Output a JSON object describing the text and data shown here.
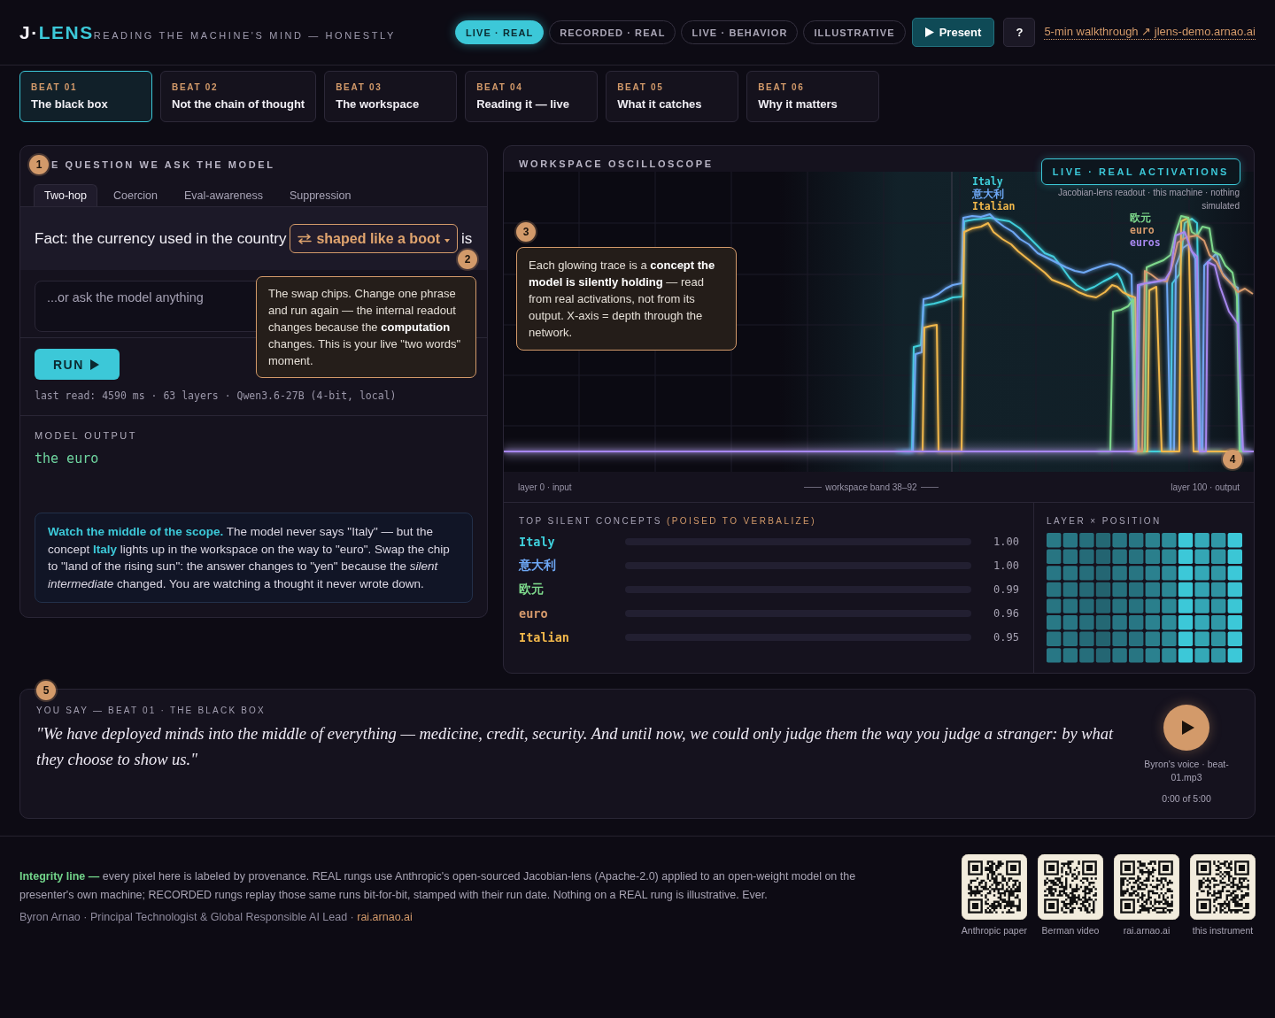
{
  "header": {
    "logo": {
      "mark": "J·",
      "accent": "LENS"
    },
    "tagline": "READING THE MACHINE'S MIND — HONESTLY",
    "modes": [
      {
        "label": "LIVE · REAL",
        "selected": true
      },
      {
        "label": "RECORDED · REAL",
        "selected": false
      },
      {
        "label": "LIVE · BEHAVIOR",
        "selected": false
      },
      {
        "label": "ILLUSTRATIVE",
        "selected": false
      }
    ],
    "present_button": {
      "label": "Present"
    },
    "help_button": {
      "label": "?"
    },
    "walkthrough_link": {
      "label": "5-min walkthrough ↗ jlens-demo.arnao.ai"
    }
  },
  "beats": [
    {
      "number": "BEAT 01",
      "title": "The black box",
      "selected": true
    },
    {
      "number": "BEAT 02",
      "title": "Not the chain of thought",
      "selected": false
    },
    {
      "number": "BEAT 03",
      "title": "The workspace",
      "selected": false
    },
    {
      "number": "BEAT 04",
      "title": "Reading it — live",
      "selected": false
    },
    {
      "number": "BEAT 05",
      "title": "What it catches",
      "selected": false
    },
    {
      "number": "BEAT 06",
      "title": "Why it matters",
      "selected": false
    }
  ],
  "question_panel": {
    "badge": "1",
    "title": "E QUESTION WE ASK THE MODEL",
    "tabs": [
      {
        "label": "Two-hop",
        "selected": true
      },
      {
        "label": "Coercion",
        "selected": false
      },
      {
        "label": "Eval-awareness",
        "selected": false
      },
      {
        "label": "Suppression",
        "selected": false
      }
    ],
    "prompt": {
      "before": "Fact: the currency used in the country",
      "chip": "shaped like a boot",
      "after": "is"
    },
    "chip_badge": "2",
    "input": {
      "placeholder": "...or ask the model anything"
    },
    "tooltip": "The swap chips. Change one phrase and run again — the internal readout changes because the **computation** changes. This is your live \"two words\" moment.",
    "run_button": {
      "label": "RUN"
    },
    "meta": "last read: 4590 ms · 63 layers · Qwen3.6-27B (4-bit, local)",
    "output": {
      "label": "MODEL OUTPUT",
      "text": "the euro"
    },
    "note": "**Watch the middle of the scope.** The model never says \"Italy\" — but the concept **Italy** lights up in the workspace on the way to \"euro\". Swap the chip to \"land of the rising sun\": the answer changes to \"yen\" because the *silent intermediate* changed. You are watching a thought it never wrote down."
  },
  "oscilloscope": {
    "title": "WORKSPACE OSCILLOSCOPE",
    "badge": "LIVE · REAL ACTIVATIONS",
    "subtitle": "Jacobian-lens readout · this machine · nothing simulated",
    "traces": [
      {
        "label": "Italy",
        "color": "#3fd0dc"
      },
      {
        "label": "意大利",
        "color": "#6ea8f5"
      },
      {
        "label": "Italian",
        "color": "#f2b84b"
      },
      {
        "label": "欧元",
        "color": "#7ed98c"
      },
      {
        "label": "euro",
        "color": "#d69a6c"
      },
      {
        "label": "euros",
        "color": "#a888f0"
      }
    ],
    "callout_badge": "3",
    "callout": "Each glowing trace is a **concept the model is silently holding** — read from real activations, not from its output. X-axis = depth through the network.",
    "axis": {
      "start": "layer 0 · input",
      "band": "workspace band 38–92",
      "end": "layer 100 · output"
    },
    "axis_badge": "4"
  },
  "concepts": {
    "title": "TOP SILENT CONCEPTS",
    "title_note": "(POISED TO VERBALIZE)",
    "items": [
      {
        "name": "Italy",
        "color": "#3fd0dc",
        "score": "1.00"
      },
      {
        "name": "意大利",
        "color": "#6ea8f5",
        "score": "1.00"
      },
      {
        "name": "欧元",
        "color": "#7ed98c",
        "score": "0.99"
      },
      {
        "name": "euro",
        "color": "#d69a6c",
        "score": "0.96"
      },
      {
        "name": "Italian",
        "color": "#f2b84b",
        "score": "0.95"
      }
    ]
  },
  "heatmap": {
    "title": "LAYER × POSITION"
  },
  "speaker_note": {
    "badge": "5",
    "label": "YOU SAY — BEAT 01 · THE BLACK BOX",
    "quote": "\"We have deployed minds into the middle of everything — medicine, credit, security. And until now, we could only judge them the way you judge a stranger: by what they choose to show us.\"",
    "audio": {
      "caption": "Byron's voice · beat-01.mp3",
      "time": "0:00 of 5:00"
    }
  },
  "footer": {
    "integrity": "**Integrity line —** every pixel here is labeled by provenance. REAL rungs use Anthropic's open-sourced Jacobian-lens (Apache-2.0) applied to an open-weight model on the presenter's own machine; RECORDED rungs replay those same runs bit-for-bit, stamped with their run date. Nothing on a REAL rung is illustrative. Ever.",
    "credit": "Byron Arnao · Principal Technologist & Global Responsible AI Lead ·",
    "credit_link": "rai.arnao.ai",
    "qr_codes": [
      {
        "caption": "Anthropic paper"
      },
      {
        "caption": "Berman video"
      },
      {
        "caption": "rai.arnao.ai"
      },
      {
        "caption": "this instrument"
      }
    ]
  }
}
